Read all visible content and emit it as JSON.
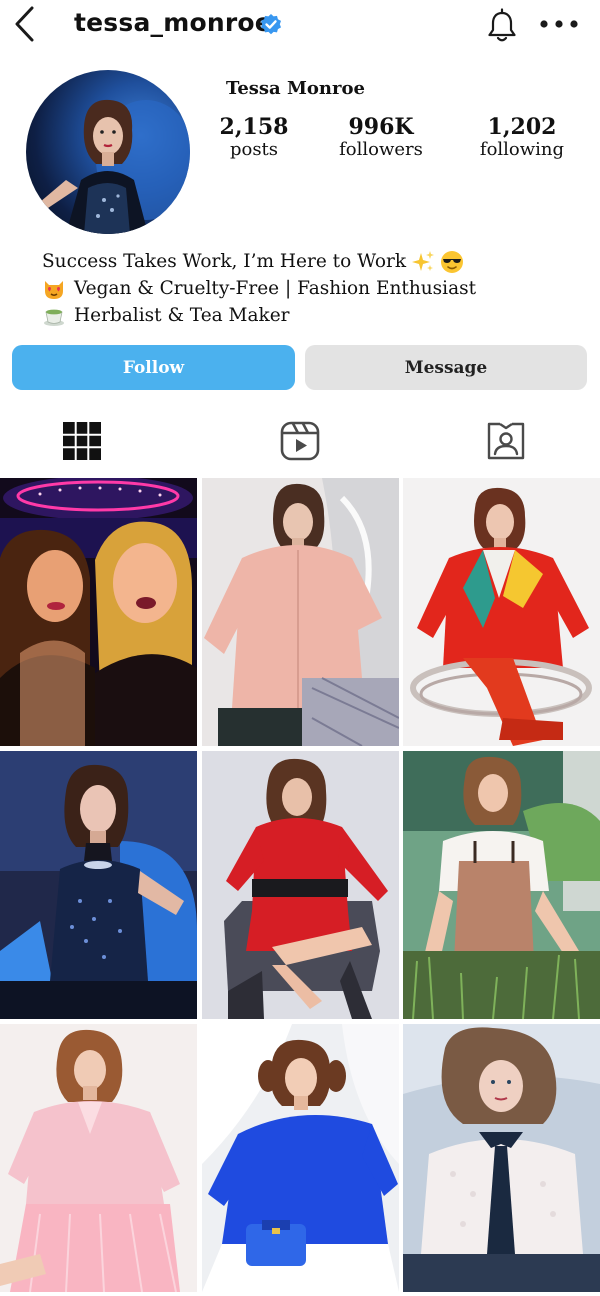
{
  "header": {
    "username": "tessa_monroe",
    "icons": [
      "back-arrow-icon",
      "verified-badge-icon",
      "bell-icon",
      "more-options-icon"
    ]
  },
  "profile": {
    "display_name": "Tessa Monroe",
    "stats": {
      "posts": {
        "value": "2,158",
        "label": "posts"
      },
      "followers": {
        "value": "996K",
        "label": "followers"
      },
      "following": {
        "value": "1,202",
        "label": "following"
      }
    },
    "bio": {
      "line1": "Success Takes Work, I’m Here to Work",
      "line2": "Vegan & Cruelty-Free | Fashion Enthusiast",
      "line3": "Herbalist & Tea Maker",
      "emojis": [
        "sparkles-emoji",
        "sunglasses-face-emoji",
        "heart-eyes-cat-emoji",
        "tea-emoji"
      ]
    }
  },
  "actions": {
    "follow_label": "Follow",
    "message_label": "Message"
  },
  "tabs": [
    {
      "name": "posts-grid",
      "icon": "grid-icon",
      "active": true
    },
    {
      "name": "reels",
      "icon": "reels-icon",
      "active": false
    },
    {
      "name": "tagged",
      "icon": "tagged-user-icon",
      "active": false
    }
  ],
  "colors": {
    "follow_button": "#4bb1ee",
    "message_button": "#e3e3e3",
    "verified_badge": "#3897f0"
  },
  "posts": [
    {
      "subject": "two women selfie under neon lights"
    },
    {
      "subject": "woman in pink coat"
    },
    {
      "subject": "woman in red blazer on clear chair"
    },
    {
      "subject": "woman in sequin halter on blue chair"
    },
    {
      "subject": "woman in red coat dress on office chair"
    },
    {
      "subject": "woman in overalls gardening"
    },
    {
      "subject": "woman in pink shirt"
    },
    {
      "subject": "woman in blue dress with handbag"
    },
    {
      "subject": "woman in white blouse with black tie"
    }
  ]
}
